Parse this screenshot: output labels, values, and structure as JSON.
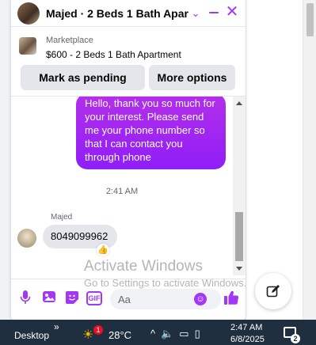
{
  "chat": {
    "title": "Majed · 2 Beds 1 Bath Apar...",
    "listing": {
      "label": "Marketplace",
      "title": "$600 - 2 Beds 1 Bath Apartment",
      "mark_pending_label": "Mark as pending",
      "more_options_label": "More options"
    },
    "messages": {
      "outgoing_text": "Hello, thank you so much for your interest. Please send me your phone number so that I can contact you through phone",
      "timestamp": "2:41 AM",
      "sender_name": "Majed",
      "incoming_text": "8049099962",
      "reaction": "👍"
    },
    "composer": {
      "placeholder": "Aa",
      "gif_label": "GIF"
    }
  },
  "watermark": {
    "title": "Activate Windows",
    "subtitle": "Go to Settings to activate Windows."
  },
  "taskbar": {
    "desktop_label": "Desktop",
    "chevron": "»",
    "weather_badge": "1",
    "temperature": "28°C",
    "time": "2:47 AM",
    "date": "6/8/2025",
    "notification_count": "2"
  },
  "colors": {
    "accent": "#a437f5",
    "bubble_gradient_top": "#b42fea",
    "bubble_gradient_bottom": "#8f1ef8",
    "taskbar": "#1f2f3f"
  }
}
